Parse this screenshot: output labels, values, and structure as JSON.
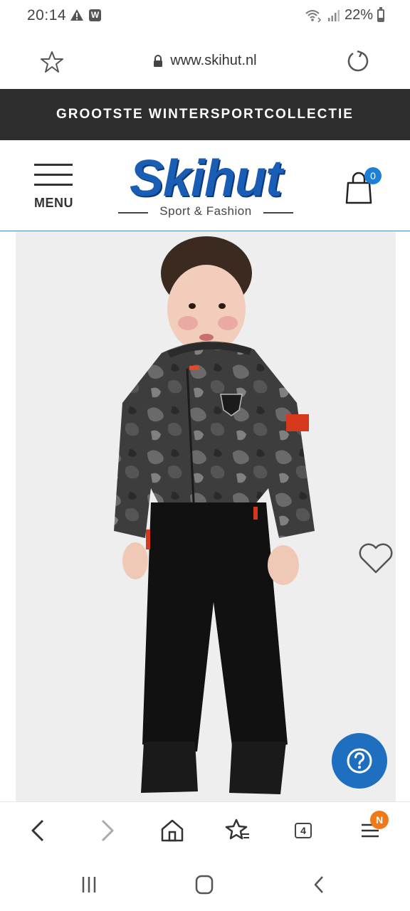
{
  "status_bar": {
    "time": "20:14",
    "battery": "22%",
    "notification_icons": [
      "warning-icon",
      "w-app-icon"
    ]
  },
  "browser": {
    "url": "www.skihut.nl",
    "tabs_count": "4",
    "menu_badge": "N"
  },
  "promo": {
    "text": "GROOTSTE WINTERSPORTCOLLECTIE"
  },
  "header": {
    "menu_label": "MENU",
    "logo_text": "Skihut",
    "logo_tagline": "Sport & Fashion",
    "cart_count": "0"
  },
  "colors": {
    "brand_blue": "#1a5db4",
    "banner_bg": "#2d2d2d",
    "badge_blue": "#1e7fd6",
    "help_blue": "#1e6fc0",
    "badge_orange": "#f07a1a"
  }
}
